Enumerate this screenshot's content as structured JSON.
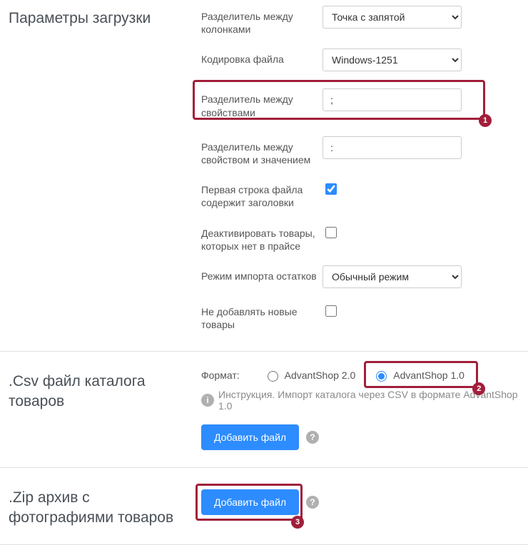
{
  "sections": {
    "upload_params": {
      "title": "Параметры загрузки",
      "fields": {
        "column_sep": {
          "label": "Разделитель между колонками",
          "value": "Точка с запятой"
        },
        "encoding": {
          "label": "Кодировка файла",
          "value": "Windows-1251"
        },
        "prop_sep": {
          "label": "Разделитель между свойствами",
          "value": ";"
        },
        "propval_sep": {
          "label": "Разделитель между свойством и значением",
          "value": ":"
        },
        "first_row_headers": {
          "label": "Первая строка файла содержит заголовки",
          "checked": true
        },
        "deactivate_missing": {
          "label": "Деактивировать товары, которых нет в прайсе",
          "checked": false
        },
        "stock_import_mode": {
          "label": "Режим импорта остатков",
          "value": "Обычный режим"
        },
        "no_add_new": {
          "label": "Не добавлять новые товары",
          "checked": false
        }
      }
    },
    "csv_file": {
      "title": ".Csv файл каталога товаров",
      "format_label": "Формат:",
      "radio_option1": "AdvantShop 2.0",
      "radio_option2": "AdvantShop 1.0",
      "instruction": "Инструкция. Импорт каталога через CSV в формате AdvantShop 1.0",
      "add_file_btn": "Добавить файл"
    },
    "zip_archive": {
      "title": ".Zip архив с фотографиями товаров",
      "add_file_btn": "Добавить файл"
    }
  },
  "annotations": {
    "badge1": "1",
    "badge2": "2",
    "badge3": "3"
  }
}
